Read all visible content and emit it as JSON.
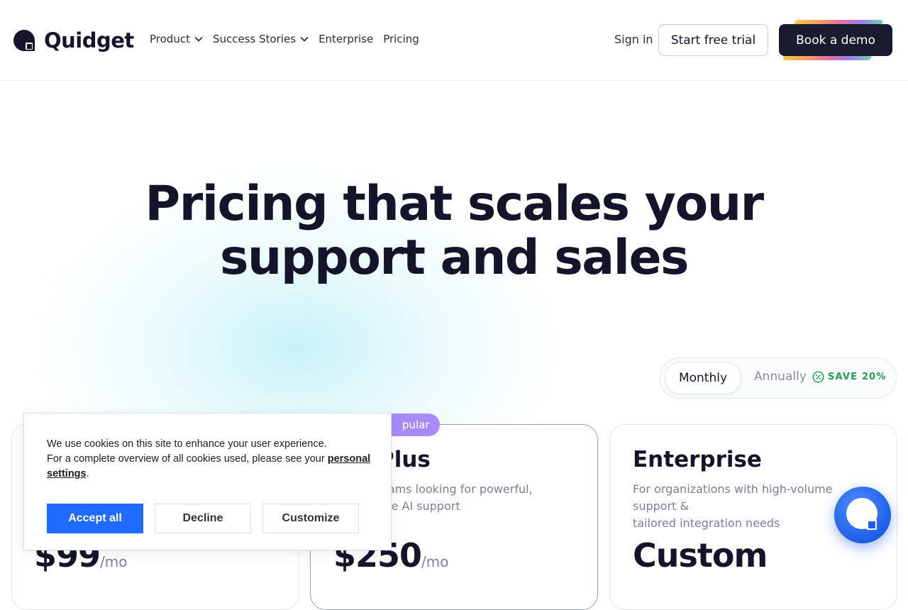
{
  "brand": {
    "name": "Quidget"
  },
  "nav": {
    "items": [
      {
        "label": "Product",
        "has_dropdown": true
      },
      {
        "label": "Success Stories",
        "has_dropdown": true
      },
      {
        "label": "Enterprise",
        "has_dropdown": false
      },
      {
        "label": "Pricing",
        "has_dropdown": false
      }
    ],
    "sign_in": "Sign in",
    "start_trial": "Start free trial",
    "book_demo": "Book a demo"
  },
  "hero": {
    "title_line1": "Pricing that scales your",
    "title_line2": "support and sales"
  },
  "billing": {
    "monthly": "Monthly",
    "annually": "Annually",
    "save_badge": "SAVE 20%",
    "selected": "Monthly"
  },
  "plans": [
    {
      "name": "",
      "description": "",
      "price": "$99",
      "period": "/mo"
    },
    {
      "badge": "pular",
      "name": "Plus",
      "description_line1": "eams looking for powerful,",
      "description_line2": "ble AI support",
      "price": "$250",
      "period": "/mo"
    },
    {
      "name": "Enterprise",
      "description_line1": "For organizations with high-volume support &",
      "description_line2": "tailored integration needs",
      "price": "Custom",
      "period": ""
    }
  ],
  "cookie": {
    "line1": "We use cookies on this site to enhance your user experience.",
    "line2": "For a complete overview of all cookies used, please see your",
    "link": "personal settings",
    "end": ".",
    "accept": "Accept all",
    "decline": "Decline",
    "customize": "Customize"
  },
  "colors": {
    "primary_dark": "#1a1b2e",
    "accent_blue": "#1f6bff",
    "badge_purple": "#a78bfa",
    "save_green": "#1f9d55"
  }
}
